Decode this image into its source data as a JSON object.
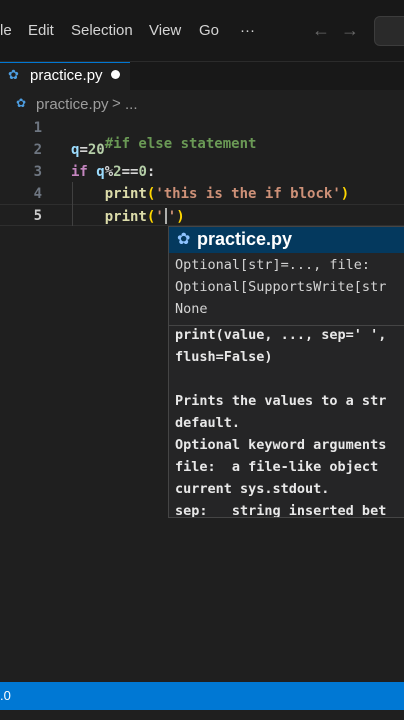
{
  "menu": {
    "items": [
      "le",
      "Edit",
      "Selection",
      "View",
      "Go",
      "···"
    ],
    "back_icon": "arrow-left-icon",
    "forward_icon": "arrow-right-icon"
  },
  "tab": {
    "label": "practice.py",
    "icon": "python-icon",
    "dirty": true
  },
  "breadcrumb": {
    "file": "practice.py",
    "separator": ">",
    "ellipsis": "..."
  },
  "editor": {
    "line_numbers": [
      "1",
      "2",
      "3",
      "4",
      "5"
    ],
    "active_line": "5",
    "lines": [
      "#if else statement",
      "q=20",
      "if q%2==0:",
      "    print('this is the if block')",
      "    print('')"
    ],
    "tokens": {
      "comment": "#if else statement",
      "q_ident": "q",
      "eq": "=",
      "twenty": "20",
      "if_kw": "if",
      "q2": "q",
      "mod": "%",
      "two": "2",
      "eqeq": "==",
      "zero": "0",
      "colon": ":",
      "print": "print",
      "lparen": "(",
      "str1": "'this is the if block'",
      "rparen": ")",
      "q_open": "'",
      "q_close": "'"
    }
  },
  "hover": {
    "title": "practice.py",
    "lines": [
      "Optional[str]=..., file:",
      "Optional[SupportsWrite[str",
      "None",
      "print(value, ..., sep=' ',",
      "flush=False)",
      "",
      "Prints the values to a str",
      "default.",
      "Optional keyword arguments",
      "file:  a file-like object",
      "current sys.stdout.",
      "sep:   string inserted bet"
    ]
  },
  "status": {
    "text": ".0",
    "color": "#0078d4"
  },
  "colors": {
    "accent": "#0078d4",
    "editor_bg": "#1f1f1f"
  }
}
